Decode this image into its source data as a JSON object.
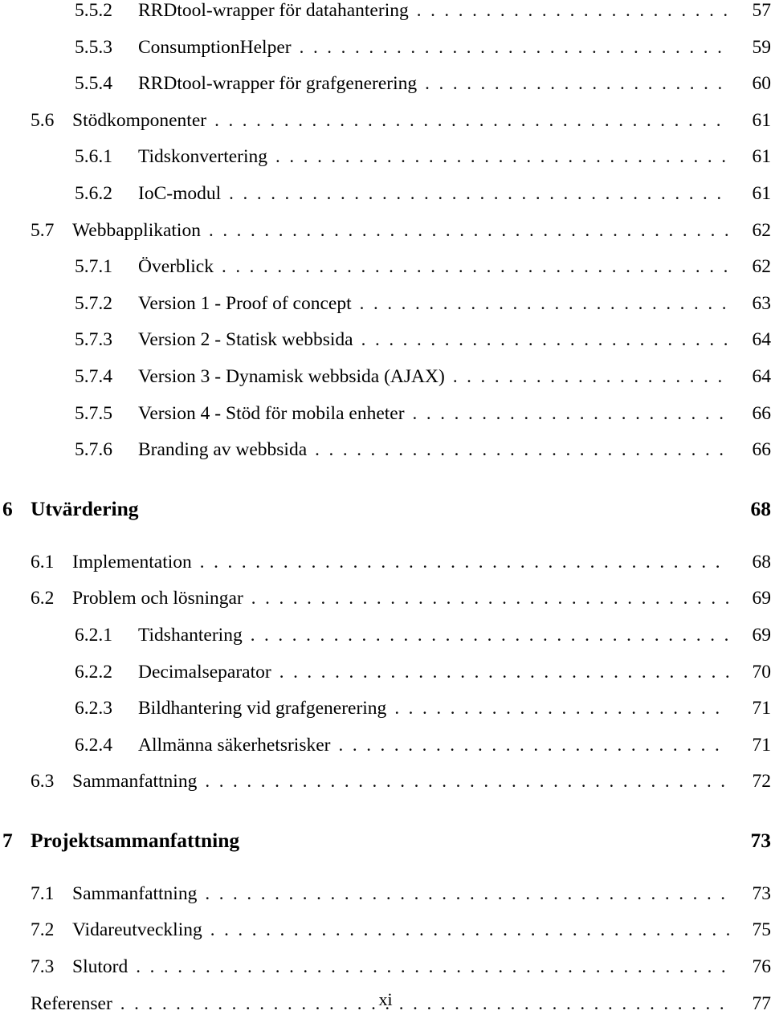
{
  "page": {
    "folio": "xi",
    "kind": "table-of-contents"
  },
  "entries": [
    {
      "level": 3,
      "number": "5.5.2",
      "title": "RRDtool-wrapper för datahantering",
      "page": "57"
    },
    {
      "level": 3,
      "number": "5.5.3",
      "title": "ConsumptionHelper",
      "page": "59"
    },
    {
      "level": 3,
      "number": "5.5.4",
      "title": "RRDtool-wrapper för grafgenerering",
      "page": "60"
    },
    {
      "level": 2,
      "number": "5.6",
      "title": "Stödkomponenter",
      "page": "61"
    },
    {
      "level": 3,
      "number": "5.6.1",
      "title": "Tidskonvertering",
      "page": "61"
    },
    {
      "level": 3,
      "number": "5.6.2",
      "title": "IoC-modul",
      "page": "61"
    },
    {
      "level": 2,
      "number": "5.7",
      "title": "Webbapplikation",
      "page": "62"
    },
    {
      "level": 3,
      "number": "5.7.1",
      "title": "Överblick",
      "page": "62"
    },
    {
      "level": 3,
      "number": "5.7.2",
      "title": "Version 1 - Proof of concept",
      "page": "63"
    },
    {
      "level": 3,
      "number": "5.7.3",
      "title": "Version 2 - Statisk webbsida",
      "page": "64"
    },
    {
      "level": 3,
      "number": "5.7.4",
      "title": "Version 3 - Dynamisk webbsida (AJAX)",
      "page": "64"
    },
    {
      "level": 3,
      "number": "5.7.5",
      "title": "Version 4 - Stöd för mobila enheter",
      "page": "66"
    },
    {
      "level": 3,
      "number": "5.7.6",
      "title": "Branding av webbsida",
      "page": "66"
    },
    {
      "level": 1,
      "number": "6",
      "title": "Utvärdering",
      "page": "68"
    },
    {
      "level": 2,
      "number": "6.1",
      "title": "Implementation",
      "page": "68"
    },
    {
      "level": 2,
      "number": "6.2",
      "title": "Problem och lösningar",
      "page": "69"
    },
    {
      "level": 3,
      "number": "6.2.1",
      "title": "Tidshantering",
      "page": "69"
    },
    {
      "level": 3,
      "number": "6.2.2",
      "title": "Decimalseparator",
      "page": "70"
    },
    {
      "level": 3,
      "number": "6.2.3",
      "title": "Bildhantering vid grafgenerering",
      "page": "71"
    },
    {
      "level": 3,
      "number": "6.2.4",
      "title": "Allmänna säkerhetsrisker",
      "page": "71"
    },
    {
      "level": 2,
      "number": "6.3",
      "title": "Sammanfattning",
      "page": "72"
    },
    {
      "level": 1,
      "number": "7",
      "title": "Projektsammanfattning",
      "page": "73"
    },
    {
      "level": 2,
      "number": "7.1",
      "title": "Sammanfattning",
      "page": "73"
    },
    {
      "level": 2,
      "number": "7.2",
      "title": "Vidareutveckling",
      "page": "75"
    },
    {
      "level": 2,
      "number": "7.3",
      "title": "Slutord",
      "page": "76"
    },
    {
      "level": 0,
      "number": "",
      "title": "Referenser",
      "page": "77"
    }
  ],
  "style": {
    "leader_dot": "."
  }
}
